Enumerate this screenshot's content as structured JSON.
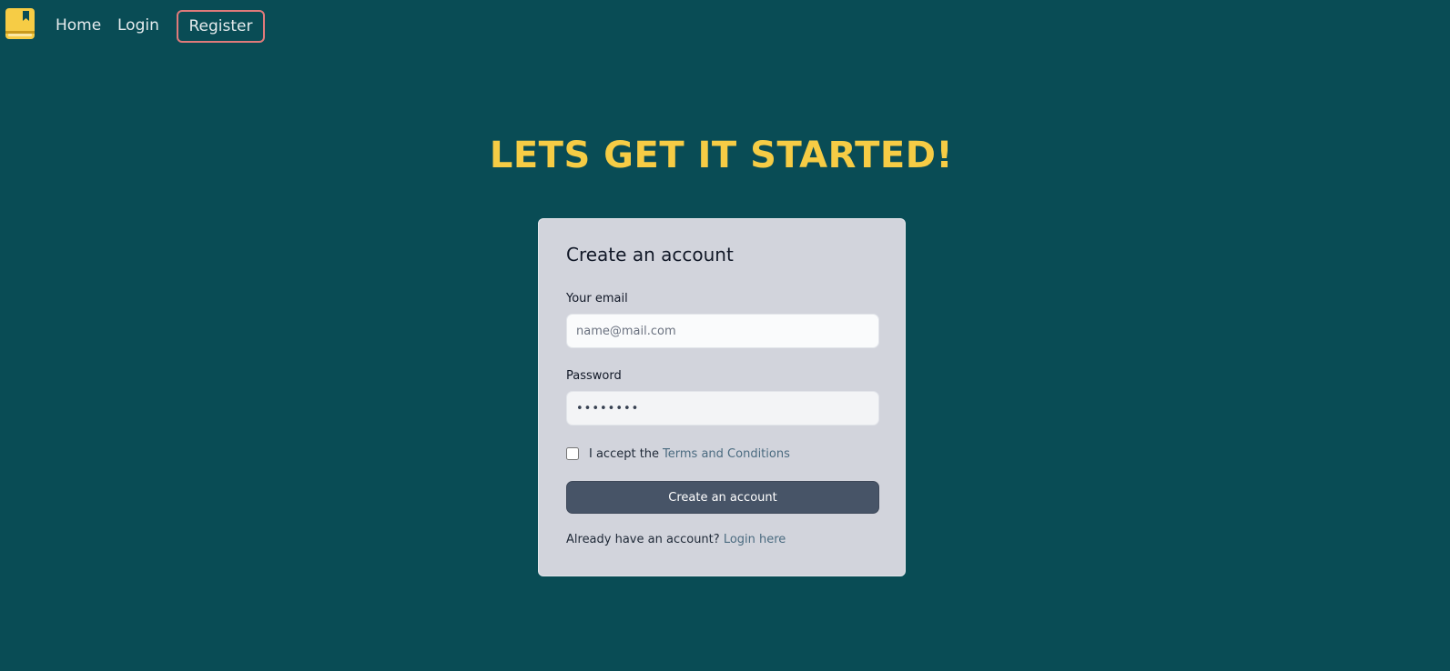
{
  "nav": {
    "logo_icon": "book-icon",
    "home_label": "Home",
    "login_label": "Login",
    "register_label": "Register"
  },
  "hero": {
    "title": "LETS GET IT STARTED!"
  },
  "form": {
    "title": "Create an account",
    "email_label": "Your email",
    "email_placeholder": "name@mail.com",
    "email_value": "",
    "password_label": "Password",
    "password_value": "••••••••",
    "accept_text": "I accept the",
    "terms_link": "Terms and Conditions",
    "terms_checked": false,
    "submit_label": "Create an account",
    "footer_text": "Already have an account?",
    "login_link": "Login here"
  },
  "colors": {
    "background": "#094C55",
    "accent": "#F6CC45",
    "register_border": "#E07A7A",
    "card": "#D2D4DC",
    "button": "#475467",
    "link": "#4B6B80"
  }
}
